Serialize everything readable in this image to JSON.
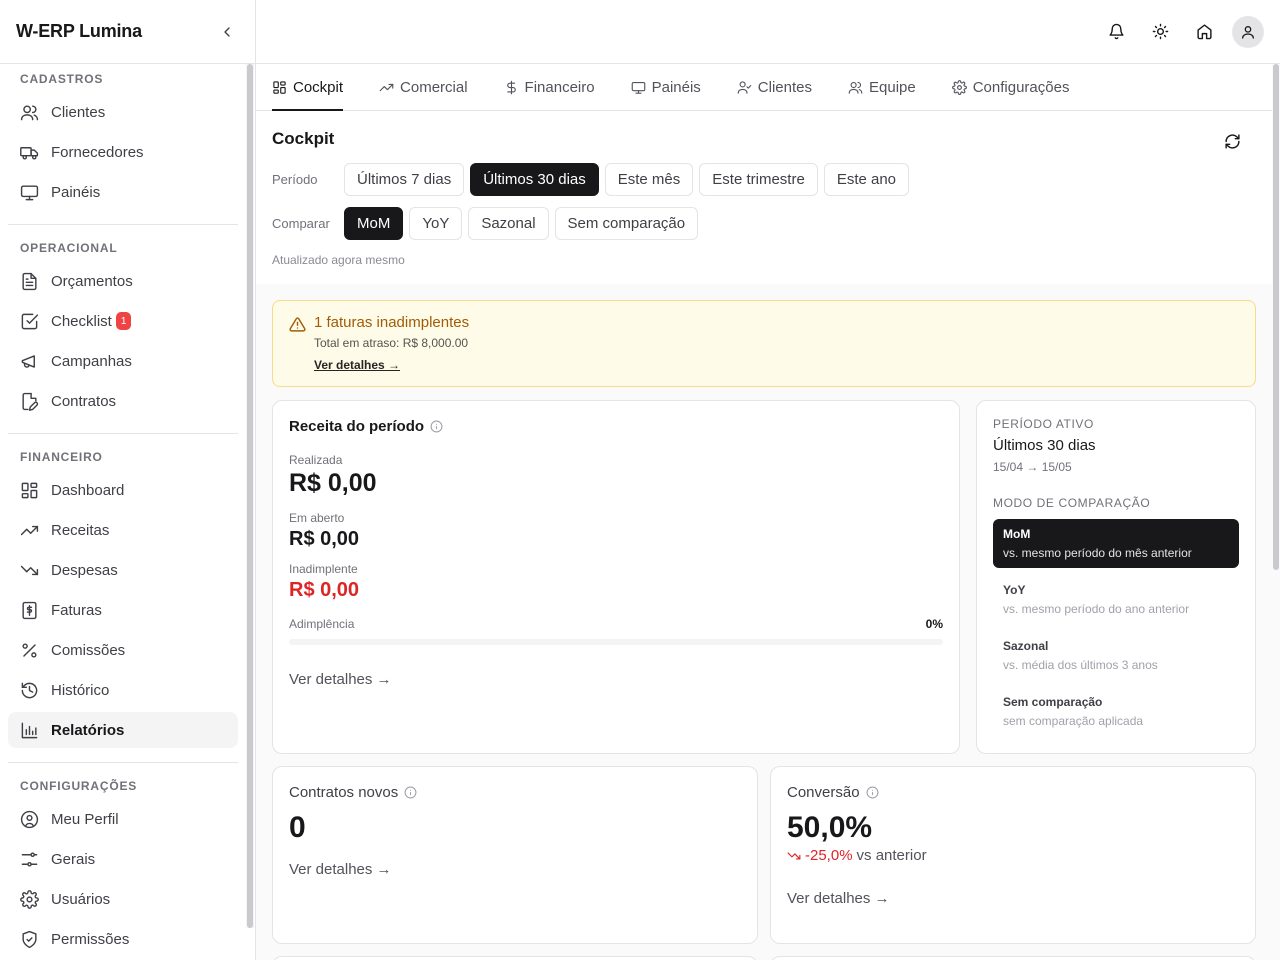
{
  "app": {
    "title": "W-ERP Lumina"
  },
  "sidebar": {
    "sections": [
      {
        "label": "CADASTROS",
        "items": [
          {
            "label": "Clientes",
            "icon": "users-icon"
          },
          {
            "label": "Fornecedores",
            "icon": "truck-icon"
          },
          {
            "label": "Painéis",
            "icon": "monitor-icon"
          }
        ]
      },
      {
        "label": "OPERACIONAL",
        "items": [
          {
            "label": "Orçamentos",
            "icon": "file-text-icon"
          },
          {
            "label": "Checklist",
            "icon": "check-square-icon",
            "badge": "1"
          },
          {
            "label": "Campanhas",
            "icon": "megaphone-icon"
          },
          {
            "label": "Contratos",
            "icon": "file-edit-icon"
          }
        ]
      },
      {
        "label": "FINANCEIRO",
        "items": [
          {
            "label": "Dashboard",
            "icon": "layout-grid-icon"
          },
          {
            "label": "Receitas",
            "icon": "trending-up-icon"
          },
          {
            "label": "Despesas",
            "icon": "trending-down-icon"
          },
          {
            "label": "Faturas",
            "icon": "receipt-dollar-icon"
          },
          {
            "label": "Comissões",
            "icon": "percent-icon"
          },
          {
            "label": "Histórico",
            "icon": "history-icon"
          },
          {
            "label": "Relatórios",
            "icon": "bar-chart-icon",
            "active": true
          }
        ]
      },
      {
        "label": "CONFIGURAÇÕES",
        "items": [
          {
            "label": "Meu Perfil",
            "icon": "user-circle-icon"
          },
          {
            "label": "Gerais",
            "icon": "sliders-icon"
          },
          {
            "label": "Usuários",
            "icon": "gear-icon"
          },
          {
            "label": "Permissões",
            "icon": "shield-icon"
          }
        ]
      }
    ]
  },
  "tabs": [
    {
      "label": "Cockpit",
      "icon": "layout-grid-icon",
      "active": true
    },
    {
      "label": "Comercial",
      "icon": "trending-up-icon"
    },
    {
      "label": "Financeiro",
      "icon": "dollar-icon"
    },
    {
      "label": "Painéis",
      "icon": "monitor-icon"
    },
    {
      "label": "Clientes",
      "icon": "user-check-icon"
    },
    {
      "label": "Equipe",
      "icon": "users-icon"
    },
    {
      "label": "Configurações",
      "icon": "gear-icon"
    }
  ],
  "cockpit": {
    "title": "Cockpit",
    "period_label": "Período",
    "periods": [
      "Últimos 7 dias",
      "Últimos 30 dias",
      "Este mês",
      "Este trimestre",
      "Este ano"
    ],
    "period_active": 1,
    "compare_label": "Comparar",
    "compares": [
      "MoM",
      "YoY",
      "Sazonal",
      "Sem comparação"
    ],
    "compare_active": 0,
    "updated": "Atualizado agora mesmo"
  },
  "alert": {
    "title": "1 faturas inadimplentes",
    "subtitle": "Total em atraso: R$ 8,000.00",
    "link": "Ver detalhes →"
  },
  "revenue": {
    "title": "Receita do período",
    "realized_label": "Realizada",
    "realized_value": "R$ 0,00",
    "open_label": "Em aberto",
    "open_value": "R$ 0,00",
    "overdue_label": "Inadimplente",
    "overdue_value": "R$ 0,00",
    "adimplencia_label": "Adimplência",
    "adimplencia_value": "0%",
    "adimplencia_fraction": 0,
    "link": "Ver detalhes →"
  },
  "period_panel": {
    "active_label": "PERÍODO ATIVO",
    "active_value": "Últimos 30 dias",
    "range": "15/04 → 15/05",
    "mode_label": "MODO DE COMPARAÇÃO",
    "modes": [
      {
        "name": "MoM",
        "desc": "vs. mesmo período do mês anterior",
        "active": true
      },
      {
        "name": "YoY",
        "desc": "vs. mesmo período do ano anterior"
      },
      {
        "name": "Sazonal",
        "desc": "vs. média dos últimos 3 anos"
      },
      {
        "name": "Sem comparação",
        "desc": "sem comparação aplicada"
      }
    ]
  },
  "contracts": {
    "title": "Contratos novos",
    "value": "0",
    "link": "Ver detalhes →"
  },
  "conversion": {
    "title": "Conversão",
    "value": "50,0%",
    "delta": "-25,0%",
    "delta_suffix": "vs anterior",
    "link": "Ver detalhes →"
  },
  "colors": {
    "accent": "#18181b",
    "danger": "#dc2626",
    "warning_bg": "#fefbe8",
    "warning_text": "#a15c07"
  }
}
